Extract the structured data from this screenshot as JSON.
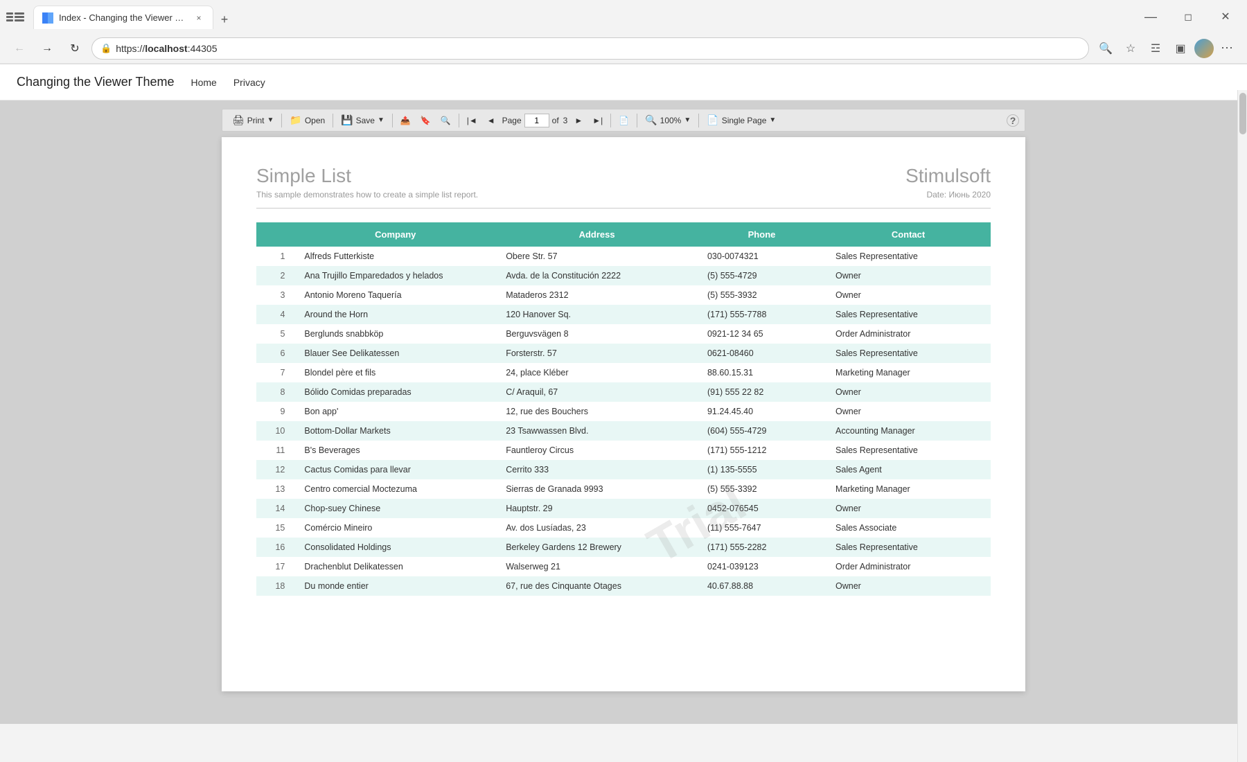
{
  "browser": {
    "tab": {
      "favicon_text": "/",
      "title": "Index - Changing the Viewer The",
      "close_label": "×"
    },
    "new_tab_label": "+",
    "address": "https://localhost:44305",
    "address_display": {
      "protocol": "https://",
      "host": "localhost",
      "port": ":44305"
    }
  },
  "page_header": {
    "title": "Changing the Viewer Theme",
    "nav_links": [
      "Home",
      "Privacy"
    ]
  },
  "toolbar": {
    "print_label": "Print",
    "open_label": "Open",
    "save_label": "Save",
    "page_label": "Page",
    "page_current": "1",
    "page_total": "3",
    "zoom_label": "100%",
    "view_label": "Single Page",
    "help_label": "?"
  },
  "report": {
    "title": "Simple List",
    "subtitle": "This sample demonstrates how to create a simple list report.",
    "brand": "Stimulsoft",
    "date_label": "Date: Июнь 2020",
    "columns": [
      "Company",
      "Address",
      "Phone",
      "Contact"
    ],
    "rows": [
      {
        "num": 1,
        "company": "Alfreds Futterkiste",
        "address": "Obere Str. 57",
        "phone": "030-0074321",
        "contact": "Sales Representative"
      },
      {
        "num": 2,
        "company": "Ana Trujillo Emparedados y helados",
        "address": "Avda. de la Constitución 2222",
        "phone": "(5) 555-4729",
        "contact": "Owner"
      },
      {
        "num": 3,
        "company": "Antonio Moreno Taquería",
        "address": "Mataderos  2312",
        "phone": "(5) 555-3932",
        "contact": "Owner"
      },
      {
        "num": 4,
        "company": "Around the Horn",
        "address": "120 Hanover Sq.",
        "phone": "(171) 555-7788",
        "contact": "Sales Representative"
      },
      {
        "num": 5,
        "company": "Berglunds snabbköp",
        "address": "Berguvsvägen  8",
        "phone": "0921-12 34 65",
        "contact": "Order Administrator"
      },
      {
        "num": 6,
        "company": "Blauer See Delikatessen",
        "address": "Forsterstr. 57",
        "phone": "0621-08460",
        "contact": "Sales Representative"
      },
      {
        "num": 7,
        "company": "Blondel père et fils",
        "address": "24, place Kléber",
        "phone": "88.60.15.31",
        "contact": "Marketing Manager"
      },
      {
        "num": 8,
        "company": "Bólido Comidas preparadas",
        "address": "C/ Araquil, 67",
        "phone": "(91) 555 22 82",
        "contact": "Owner"
      },
      {
        "num": 9,
        "company": "Bon app'",
        "address": "12, rue des Bouchers",
        "phone": "91.24.45.40",
        "contact": "Owner"
      },
      {
        "num": 10,
        "company": "Bottom-Dollar Markets",
        "address": "23 Tsawwassen Blvd.",
        "phone": "(604) 555-4729",
        "contact": "Accounting Manager"
      },
      {
        "num": 11,
        "company": "B's Beverages",
        "address": "Fauntleroy Circus",
        "phone": "(171) 555-1212",
        "contact": "Sales Representative"
      },
      {
        "num": 12,
        "company": "Cactus Comidas para llevar",
        "address": "Cerrito 333",
        "phone": "(1) 135-5555",
        "contact": "Sales Agent"
      },
      {
        "num": 13,
        "company": "Centro comercial Moctezuma",
        "address": "Sierras de Granada 9993",
        "phone": "(5) 555-3392",
        "contact": "Marketing Manager"
      },
      {
        "num": 14,
        "company": "Chop-suey Chinese",
        "address": "Hauptstr. 29",
        "phone": "0452-076545",
        "contact": "Owner"
      },
      {
        "num": 15,
        "company": "Comércio Mineiro",
        "address": "Av. dos Lusíadas, 23",
        "phone": "(11) 555-7647",
        "contact": "Sales Associate"
      },
      {
        "num": 16,
        "company": "Consolidated Holdings",
        "address": "Berkeley Gardens 12  Brewery",
        "phone": "(171) 555-2282",
        "contact": "Sales Representative"
      },
      {
        "num": 17,
        "company": "Drachenblut Delikatessen",
        "address": "Walserweg 21",
        "phone": "0241-039123",
        "contact": "Order Administrator"
      },
      {
        "num": 18,
        "company": "Du monde entier",
        "address": "67, rue des Cinquante Otages",
        "phone": "40.67.88.88",
        "contact": "Owner"
      }
    ],
    "watermark": "Trial"
  }
}
